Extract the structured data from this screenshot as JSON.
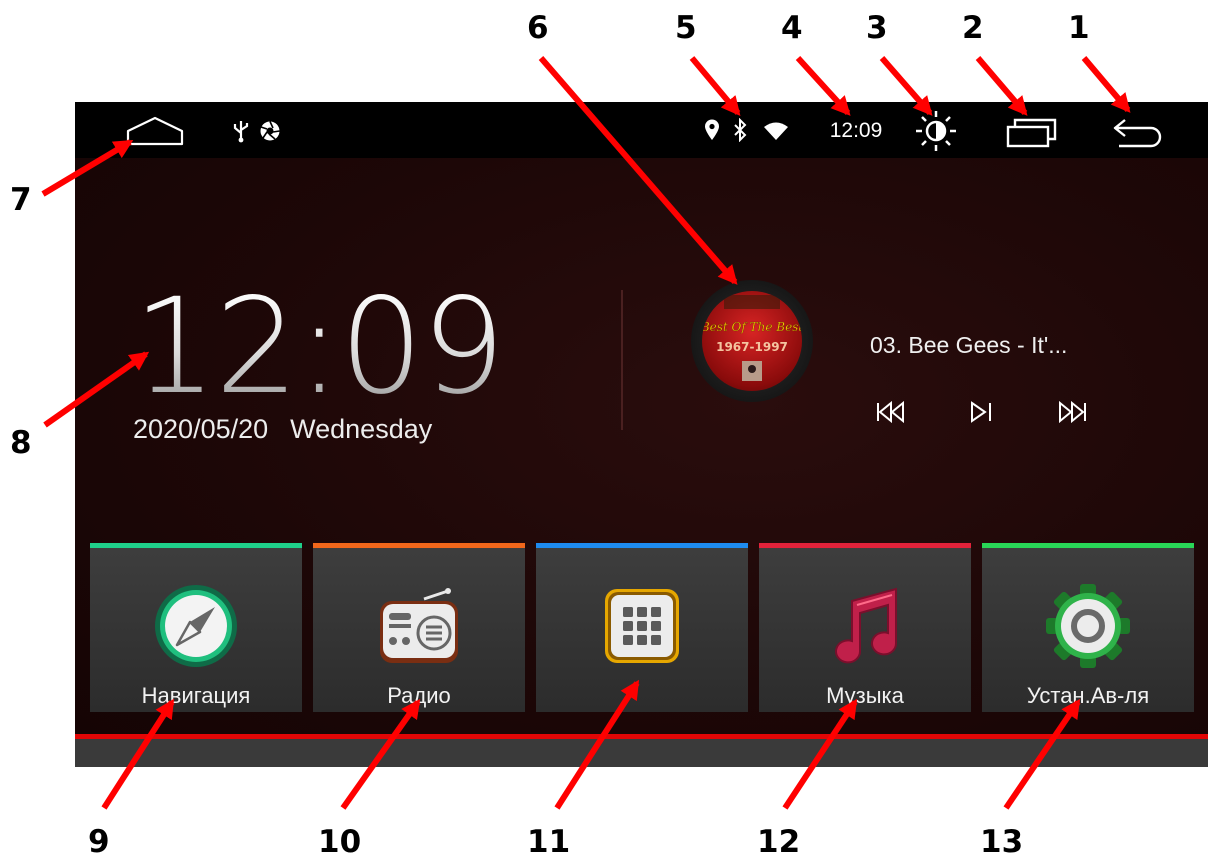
{
  "status_bar": {
    "time": "12:09",
    "left_icons": [
      "home-icon",
      "usb-icon",
      "aperture-icon"
    ],
    "right_icons": [
      "location-icon",
      "bluetooth-icon",
      "wifi-icon",
      "brightness-icon",
      "recent-apps-icon",
      "back-icon"
    ]
  },
  "clock": {
    "time": "12:09",
    "date": "2020/05/20",
    "weekday": "Wednesday"
  },
  "media": {
    "track": "03. Bee Gees - It'...",
    "album_art_text": [
      "Best Of The Best",
      "1967-1997"
    ],
    "controls": [
      "previous-icon",
      "play-pause-icon",
      "next-icon"
    ]
  },
  "apps": [
    {
      "label": "Навигация",
      "accent": "#1fd08a",
      "icon": "compass-icon"
    },
    {
      "label": "Радио",
      "accent": "#f2671b",
      "icon": "radio-icon"
    },
    {
      "label": "",
      "accent": "#1e8bf0",
      "icon": "app-grid-icon"
    },
    {
      "label": "Музыка",
      "accent": "#e2223a",
      "icon": "music-note-icon"
    },
    {
      "label": "Устан.Ав-ля",
      "accent": "#29d657",
      "icon": "settings-gear-icon"
    }
  ],
  "callouts": [
    "1",
    "2",
    "3",
    "4",
    "5",
    "6",
    "7",
    "8",
    "9",
    "10",
    "11",
    "12",
    "13"
  ],
  "colors": {
    "callout_arrow": "#ff0000",
    "bottom_line": "#e10606"
  }
}
